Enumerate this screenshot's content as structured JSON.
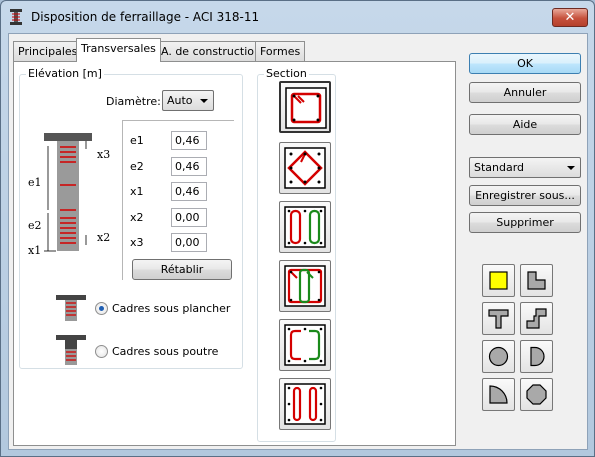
{
  "window": {
    "title": "Disposition de ferraillage - ACI 318-11",
    "close_glyph": "✕"
  },
  "tabs": [
    {
      "label": "Principales",
      "active": false
    },
    {
      "label": "Transversales",
      "active": true
    },
    {
      "label": "A. de construction",
      "active": false
    },
    {
      "label": "Formes",
      "active": false
    }
  ],
  "elevation": {
    "group_label": "Elévation [m]",
    "diametre_label": "Diamètre:",
    "diametre_value": "Auto",
    "fields": [
      {
        "label": "e1",
        "value": "0,46"
      },
      {
        "label": "e2",
        "value": "0,46"
      },
      {
        "label": "x1",
        "value": "0,46"
      },
      {
        "label": "x2",
        "value": "0,00"
      },
      {
        "label": "x3",
        "value": "0,00"
      }
    ],
    "diagram_labels": {
      "e1": "e1",
      "e2": "e2",
      "x1": "x1",
      "x2": "x2",
      "x3": "x3"
    },
    "retablir_label": "Rétablir",
    "options": [
      {
        "label": "Cadres sous plancher",
        "checked": true
      },
      {
        "label": "Cadres sous poutre",
        "checked": false
      }
    ]
  },
  "section": {
    "group_label": "Section",
    "patterns": [
      "rectangular-tie-with-hook-icon",
      "diamond-tie-icon",
      "double-vertical-ties-icon",
      "mixed-ties-with-hooks-icon",
      "c-shaped-ties-icon",
      "narrow-vertical-ties-icon"
    ]
  },
  "buttons": {
    "ok": "OK",
    "cancel": "Annuler",
    "help": "Aide",
    "preset_value": "Standard",
    "save_as": "Enregistrer sous...",
    "delete": "Supprimer"
  },
  "shapes": [
    "rectangle-shape-icon",
    "l-shape-icon",
    "t-shape-icon",
    "z-shape-icon",
    "circle-shape-icon",
    "half-circle-shape-icon",
    "quarter-circle-shape-icon",
    "octagon-shape-icon"
  ],
  "colors": {
    "tie_red": "#d40000",
    "tie_green": "#1a8a1a",
    "selected_shape": "#ffff00"
  }
}
